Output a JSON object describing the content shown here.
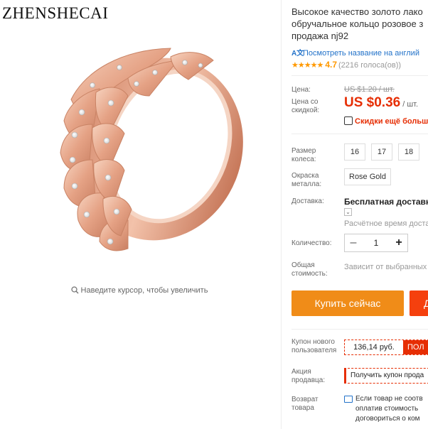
{
  "gallery": {
    "brand": "ZHENSHECAI",
    "zoom_hint": "Наведите курсор, чтобы увеличить",
    "zoom_icon": "magnifier-icon"
  },
  "product": {
    "title_lines": [
      "Высокое качество золото лако",
      "обручальное кольцо розовое з",
      "продажа nj92"
    ],
    "translate_link": "Посмотреть название на англий",
    "translate_icon": "translate-icon",
    "rating": {
      "stars": "★★★★★",
      "score": "4.7",
      "count": "(2216 голоса(ов))"
    }
  },
  "price": {
    "label": "Цена:",
    "old_value": "US $1.20 / шт.",
    "discount_label_1": "Цена со",
    "discount_label_2": "скидкой:",
    "new_value": "US $0.36",
    "unit": "/ шт.",
    "discount_note": "Скидки ещё больше"
  },
  "options": {
    "size_label_1": "Размер",
    "size_label_2": "колеса:",
    "sizes": [
      "16",
      "17",
      "18"
    ],
    "metal_label_1": "Окраска",
    "metal_label_2": "металла:",
    "metal_value": "Rose Gold"
  },
  "shipping": {
    "label": "Доставка:",
    "title": "Бесплатная доставка |",
    "caret": "⌄",
    "time": "Расчётное время доста"
  },
  "quantity": {
    "label": "Количество:",
    "minus": "–",
    "value": "1",
    "plus": "+"
  },
  "total": {
    "label_1": "Общая",
    "label_2": "стоимость:",
    "value": "Зависит от выбранных"
  },
  "actions": {
    "buy_now": "Купить сейчас",
    "add_to_cart": "Д"
  },
  "coupon": {
    "label_1": "Купон нового",
    "label_2": "пользователя",
    "amount": "136,14 руб.",
    "get": "ПОЛ"
  },
  "promo": {
    "label_1": "Акция",
    "label_2": "продавца:",
    "value": "Получить купон прода"
  },
  "returns": {
    "label_1": "Возврат",
    "label_2": "товара",
    "lines": [
      "Если товар не соотв",
      "оплатив стоимость",
      "договориться о ком"
    ]
  },
  "colors": {
    "accent_price": "#e62e04",
    "buy_button": "#f08c18",
    "cart_button": "#f5400e",
    "star": "#ff9900",
    "link": "#2272c9"
  }
}
